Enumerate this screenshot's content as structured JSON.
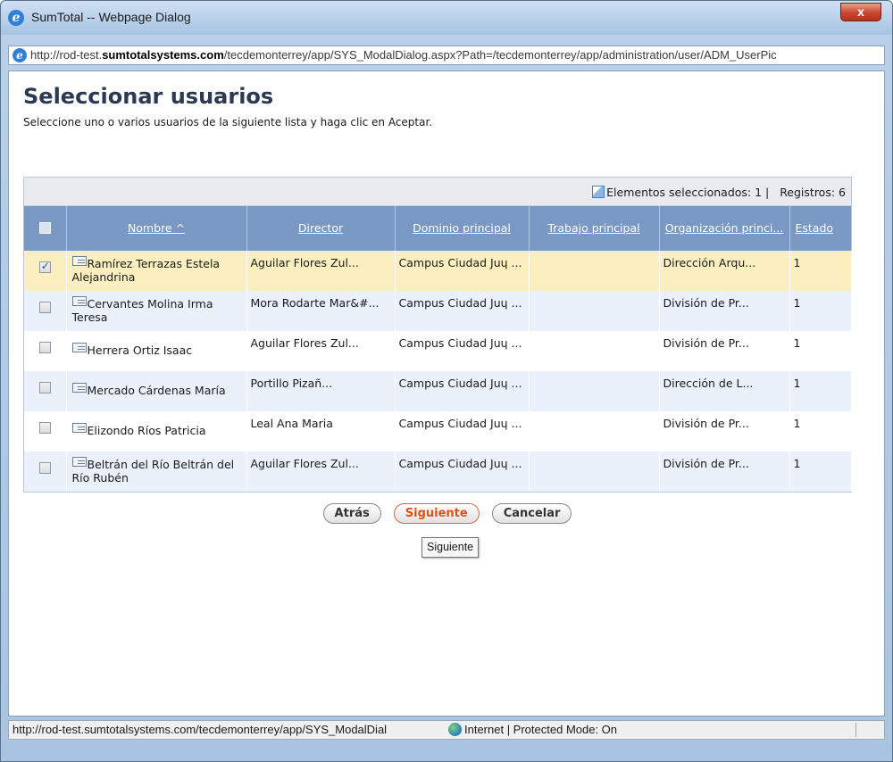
{
  "window": {
    "title": "SumTotal -- Webpage Dialog",
    "close_label": "x"
  },
  "address": {
    "url_prefix": "http://rod-test.",
    "url_domain": "sumtotalsystems.com",
    "url_suffix": "/tecdemonterrey/app/SYS_ModalDialog.aspx?Path=/tecdemonterrey/app/administration/user/ADM_UserPic"
  },
  "page": {
    "title": "Seleccionar usuarios",
    "description": "Seleccione uno o varios usuarios de la siguiente lista y haga clic en Aceptar."
  },
  "grid": {
    "selected_label": "Elementos seleccionados: 1 |",
    "records_label": "Registros: 6",
    "columns": [
      "Nombre ^",
      "Director",
      "Dominio principal",
      "Trabajo principal",
      "Organización princi...",
      "Estado"
    ],
    "rows": [
      {
        "checked": true,
        "name": "Ramírez Terrazas Estela Alejandrina",
        "director": "Aguilar Flores Zul...",
        "domain": "Campus Ciudad Juɥ ...",
        "job": "",
        "org": "Dirección Arqu...",
        "status": "1"
      },
      {
        "checked": false,
        "name": "Cervantes Molina Irma Teresa",
        "director": "Mora Rodarte Mar&#...",
        "domain": "Campus Ciudad Juɥ ...",
        "job": "",
        "org": "División de Pr...",
        "status": "1"
      },
      {
        "checked": false,
        "name": "Herrera Ortiz Isaac",
        "director": "Aguilar Flores Zul...",
        "domain": "Campus Ciudad Juɥ ...",
        "job": "",
        "org": "División de Pr...",
        "status": "1"
      },
      {
        "checked": false,
        "name": "Mercado Cárdenas María",
        "director": "Portillo Pizañ...",
        "domain": "Campus Ciudad Juɥ ...",
        "job": "",
        "org": "Dirección de L...",
        "status": "1"
      },
      {
        "checked": false,
        "name": "Elizondo Ríos Patricia",
        "director": "Leal Ana Maria",
        "domain": "Campus Ciudad Juɥ ...",
        "job": "",
        "org": "División de Pr...",
        "status": "1"
      },
      {
        "checked": false,
        "name": "Beltrán del Río Beltrán del Río Rubén",
        "director": "Aguilar Flores Zul...",
        "domain": "Campus Ciudad Juɥ ...",
        "job": "",
        "org": "División de Pr...",
        "status": "1"
      }
    ]
  },
  "buttons": {
    "back": "Atrás",
    "next": "Siguiente",
    "cancel": "Cancelar"
  },
  "tooltip": "Siguiente",
  "status": {
    "url": "http://rod-test.sumtotalsystems.com/tecdemonterrey/app/SYS_ModalDial",
    "zone": "Internet | Protected Mode: On"
  },
  "colors": {
    "header_bg": "#7a98c4",
    "selected_row": "#fbefc0",
    "alt_row": "#eaf1fa",
    "primary_button_text": "#e0501a",
    "title": "#2b3a52"
  }
}
